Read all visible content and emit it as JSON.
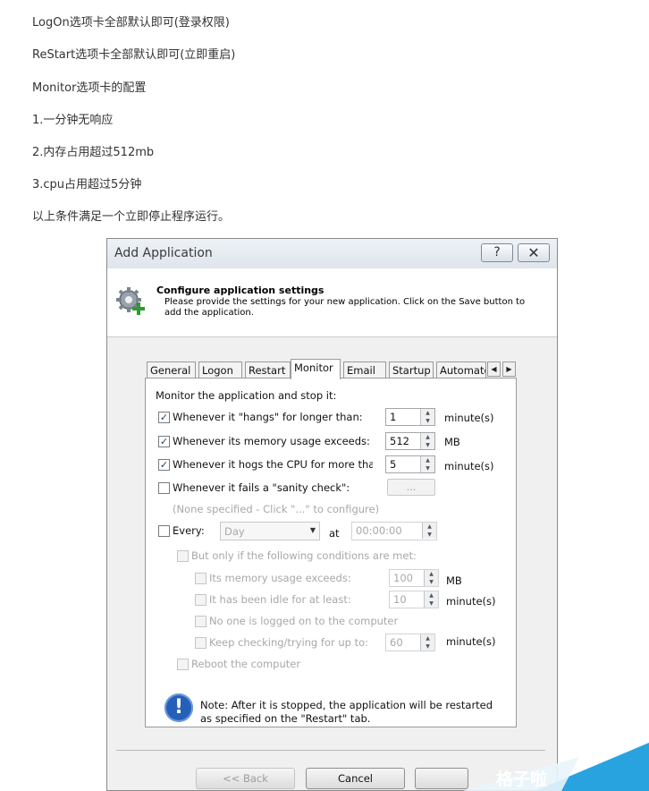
{
  "article": {
    "lines": [
      "LogOn选项卡全部默认即可(登录权限)",
      "ReStart选项卡全部默认即可(立即重启)",
      "Monitor选项卡的配置",
      "1.一分钟无响应",
      "2.内存占用超过512mb",
      "3.cpu占用超过5分钟",
      "以上条件满足一个立即停止程序运行。"
    ]
  },
  "dialog": {
    "title": "Add Application",
    "help_label": "?",
    "close_label": "✕",
    "header_title": "Configure application settings",
    "header_desc": "Please provide the settings for your new application. Click on the Save button to add the application.",
    "tabs": [
      "General",
      "Logon",
      "Restart",
      "Monitor",
      "Email",
      "Startup",
      "Automate"
    ],
    "active_tab": "Monitor",
    "monitor": {
      "section_title": "Monitor the application and stop it:",
      "hangs": {
        "label": "Whenever it \"hangs\" for longer than:",
        "checked": true,
        "value": "1",
        "unit": "minute(s)"
      },
      "memory": {
        "label": "Whenever its memory usage exceeds:",
        "checked": true,
        "value": "512",
        "unit": "MB"
      },
      "cpu": {
        "label": "Whenever it hogs the CPU for more thar",
        "checked": true,
        "value": "5",
        "unit": "minute(s)"
      },
      "sanity": {
        "label": "Whenever it fails a \"sanity check\":",
        "checked": false,
        "button": "...",
        "hint": "(None specified - Click \"...\" to configure)"
      },
      "every": {
        "label": "Every:",
        "checked": false,
        "period": "Day",
        "at_label": "at",
        "time": "00:00:00"
      },
      "conditions_label": "But only if the following conditions are met:",
      "cond_memory": {
        "label": "Its memory usage exceeds:",
        "value": "100",
        "unit": "MB"
      },
      "cond_idle": {
        "label": "It has been idle for at least:",
        "value": "10",
        "unit": "minute(s)"
      },
      "cond_nologon": {
        "label": "No one is logged on to the computer"
      },
      "cond_keep": {
        "label": "Keep checking/trying for up to:",
        "value": "60",
        "unit": "minute(s)"
      },
      "reboot_label": "Reboot the computer",
      "note": "Note: After it is stopped, the application will be restarted as specified on the \"Restart\" tab."
    },
    "buttons": {
      "back": "<< Back",
      "cancel": "Cancel"
    }
  },
  "watermark": {
    "text": "格子啦",
    "color": "#29a3e0"
  }
}
